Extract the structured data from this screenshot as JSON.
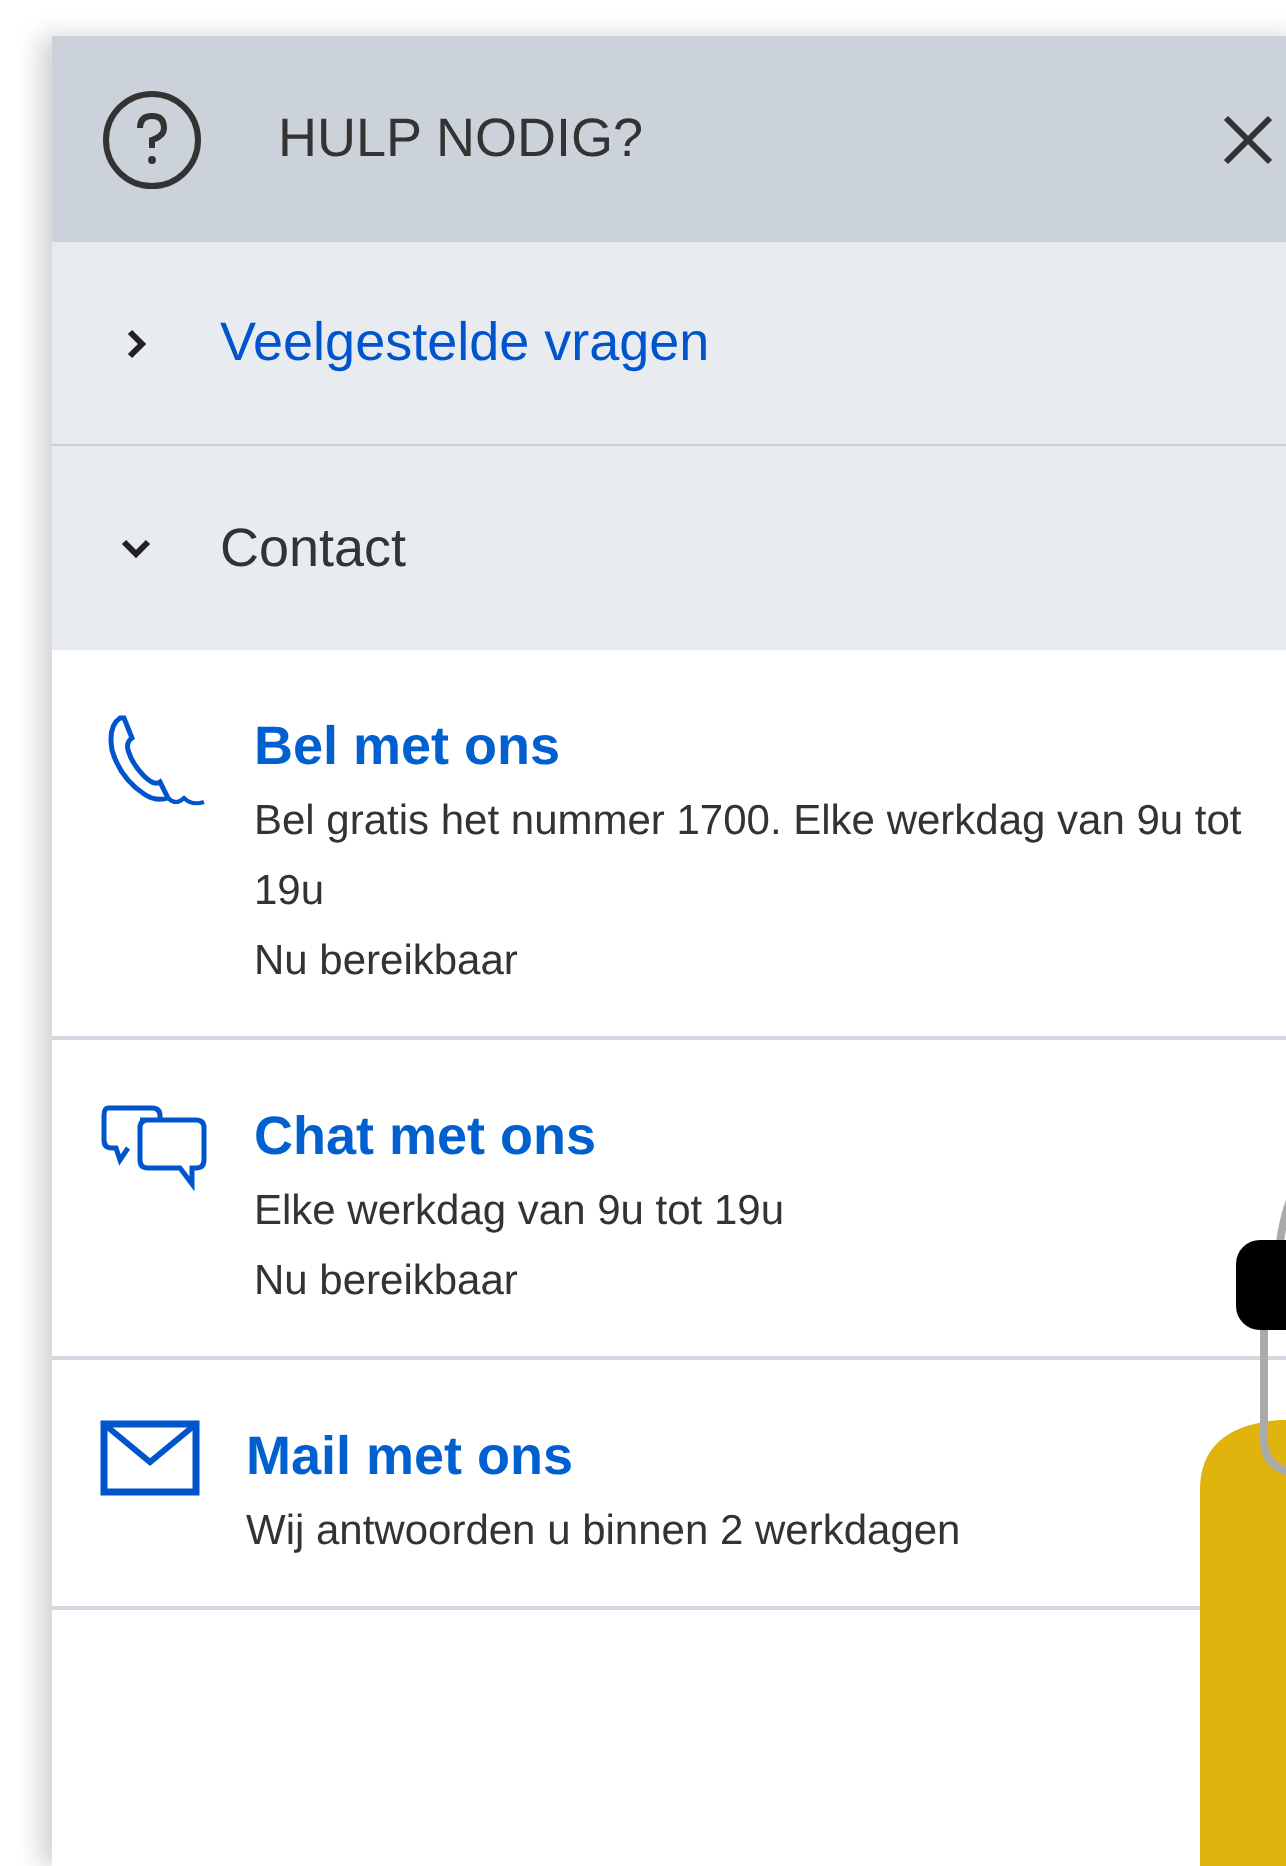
{
  "header": {
    "title": "HULP NODIG?"
  },
  "sections": [
    {
      "label": "Veelgestelde vragen",
      "expanded": false
    },
    {
      "label": "Contact",
      "expanded": true
    }
  ],
  "contact_items": [
    {
      "kind": "phone",
      "title": "Bel met ons",
      "lines": [
        "Bel gratis het nummer 1700. Elke werkdag van 9u tot 19u",
        "Nu bereikbaar"
      ]
    },
    {
      "kind": "chat",
      "title": "Chat met ons",
      "lines": [
        "Elke werkdag van 9u tot 19u",
        "Nu bereikbaar"
      ]
    },
    {
      "kind": "mail",
      "title": "Mail met ons",
      "lines": [
        "Wij antwoorden u binnen 2 werkdagen"
      ]
    }
  ]
}
